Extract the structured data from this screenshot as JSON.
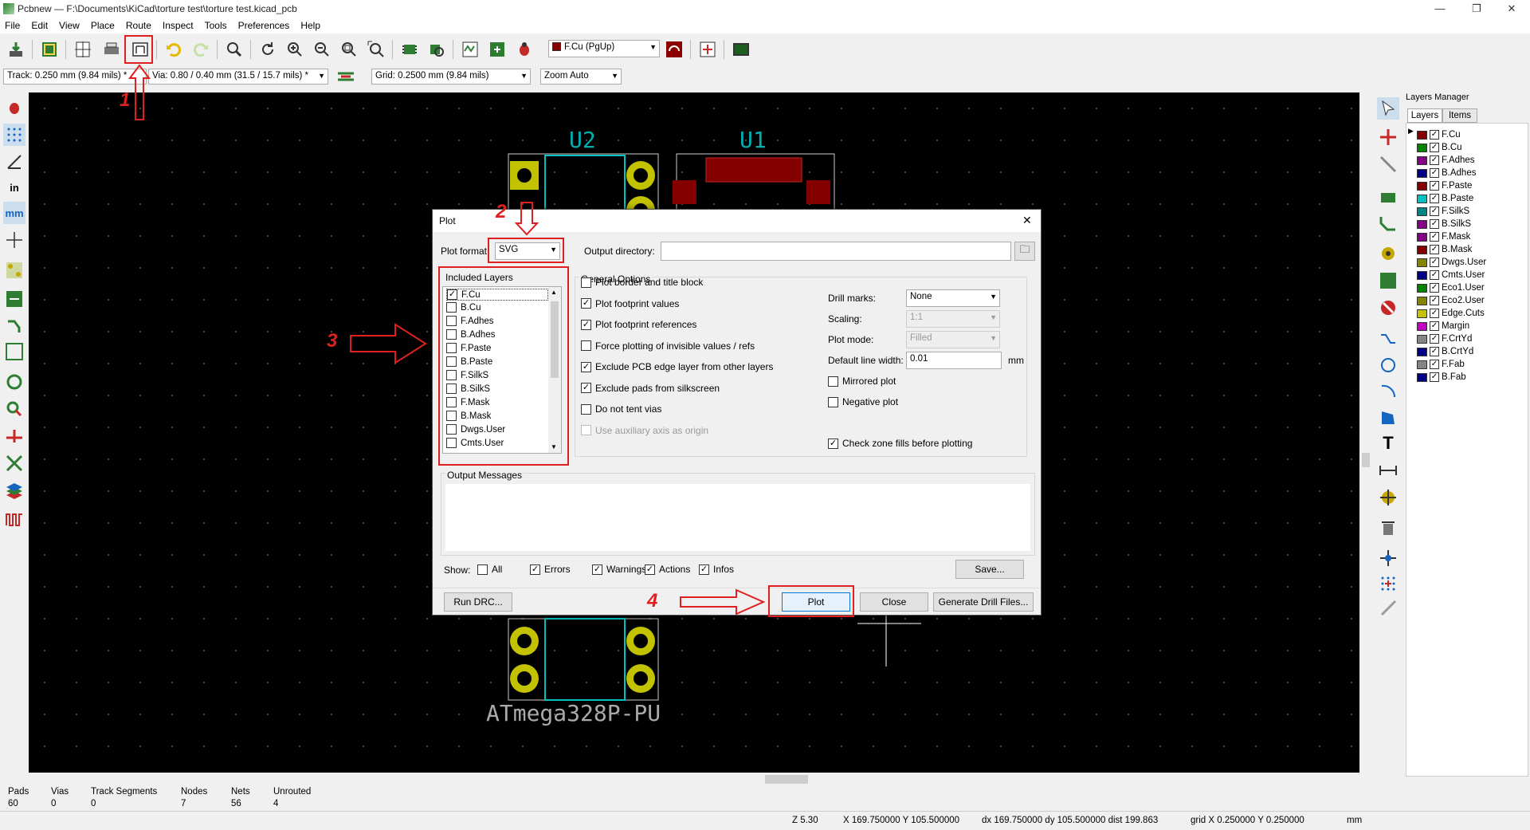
{
  "window": {
    "title": "Pcbnew — F:\\Documents\\KiCad\\torture test\\torture test.kicad_pcb",
    "minimize": "—",
    "maximize": "❐",
    "close": "✕"
  },
  "menu": [
    "File",
    "Edit",
    "View",
    "Place",
    "Route",
    "Inspect",
    "Tools",
    "Preferences",
    "Help"
  ],
  "toolbar": {
    "layer_select": "F.Cu (PgUp)"
  },
  "toolbar2": {
    "track": "Track: 0.250 mm (9.84 mils) *",
    "via": "Via: 0.80 / 0.40 mm (31.5 / 15.7 mils) *",
    "grid": "Grid: 0.2500 mm (9.84 mils)",
    "zoom": "Zoom Auto"
  },
  "pcb": {
    "u2": "U2",
    "u1": "U1",
    "part": "ATmega328P-PU"
  },
  "annotations": [
    "1",
    "2",
    "3",
    "4"
  ],
  "dialog": {
    "title": "Plot",
    "close": "✕",
    "plot_format_label": "Plot format:",
    "plot_format_value": "SVG",
    "output_dir_label": "Output directory:",
    "output_dir_value": "",
    "included_layers_title": "Included Layers",
    "layers": [
      {
        "name": "F.Cu",
        "checked": true
      },
      {
        "name": "B.Cu",
        "checked": false
      },
      {
        "name": "F.Adhes",
        "checked": false
      },
      {
        "name": "B.Adhes",
        "checked": false
      },
      {
        "name": "F.Paste",
        "checked": false
      },
      {
        "name": "B.Paste",
        "checked": false
      },
      {
        "name": "F.SilkS",
        "checked": false
      },
      {
        "name": "B.SilkS",
        "checked": false
      },
      {
        "name": "F.Mask",
        "checked": false
      },
      {
        "name": "B.Mask",
        "checked": false
      },
      {
        "name": "Dwgs.User",
        "checked": false
      },
      {
        "name": "Cmts.User",
        "checked": false
      }
    ],
    "general_title": "General Options",
    "opts_left": [
      {
        "label": "Plot border and title block",
        "checked": false,
        "disabled": false
      },
      {
        "label": "Plot footprint values",
        "checked": true,
        "disabled": false
      },
      {
        "label": "Plot footprint references",
        "checked": true,
        "disabled": false
      },
      {
        "label": "Force plotting of invisible values / refs",
        "checked": false,
        "disabled": false
      },
      {
        "label": "Exclude PCB edge layer from other layers",
        "checked": true,
        "disabled": false
      },
      {
        "label": "Exclude pads from silkscreen",
        "checked": true,
        "disabled": false
      },
      {
        "label": "Do not tent vias",
        "checked": false,
        "disabled": false
      },
      {
        "label": "Use auxiliary axis as origin",
        "checked": false,
        "disabled": true
      }
    ],
    "drill_marks_label": "Drill marks:",
    "drill_marks_value": "None",
    "scaling_label": "Scaling:",
    "scaling_value": "1:1",
    "plot_mode_label": "Plot mode:",
    "plot_mode_value": "Filled",
    "line_width_label": "Default line width:",
    "line_width_value": "0.01",
    "line_width_unit": "mm",
    "mirrored": "Mirrored plot",
    "negative": "Negative plot",
    "check_zone": "Check zone fills before plotting",
    "output_messages": "Output Messages",
    "show_label": "Show:",
    "show_opts": [
      {
        "label": "All",
        "checked": false
      },
      {
        "label": "Errors",
        "checked": true
      },
      {
        "label": "Warnings",
        "checked": true
      },
      {
        "label": "Actions",
        "checked": true
      },
      {
        "label": "Infos",
        "checked": true
      }
    ],
    "save_btn": "Save...",
    "run_drc": "Run DRC...",
    "plot_btn": "Plot",
    "close_btn": "Close",
    "drill_btn": "Generate Drill Files..."
  },
  "layers_manager": {
    "title": "Layers Manager",
    "tab_layers": "Layers",
    "tab_items": "Items",
    "layers": [
      {
        "name": "F.Cu",
        "color": "#840000"
      },
      {
        "name": "B.Cu",
        "color": "#008400"
      },
      {
        "name": "F.Adhes",
        "color": "#840084"
      },
      {
        "name": "B.Adhes",
        "color": "#000084"
      },
      {
        "name": "F.Paste",
        "color": "#840000"
      },
      {
        "name": "B.Paste",
        "color": "#00c2c2"
      },
      {
        "name": "F.SilkS",
        "color": "#008484"
      },
      {
        "name": "B.SilkS",
        "color": "#840084"
      },
      {
        "name": "F.Mask",
        "color": "#840084"
      },
      {
        "name": "B.Mask",
        "color": "#840000"
      },
      {
        "name": "Dwgs.User",
        "color": "#848400"
      },
      {
        "name": "Cmts.User",
        "color": "#000084"
      },
      {
        "name": "Eco1.User",
        "color": "#008400"
      },
      {
        "name": "Eco2.User",
        "color": "#848400"
      },
      {
        "name": "Edge.Cuts",
        "color": "#c2c200"
      },
      {
        "name": "Margin",
        "color": "#c200c2"
      },
      {
        "name": "F.CrtYd",
        "color": "#848484"
      },
      {
        "name": "B.CrtYd",
        "color": "#000084"
      },
      {
        "name": "F.Fab",
        "color": "#848484"
      },
      {
        "name": "B.Fab",
        "color": "#000084"
      }
    ]
  },
  "status": {
    "pads_l": "Pads",
    "pads_v": "60",
    "vias_l": "Vias",
    "vias_v": "0",
    "tracks_l": "Track Segments",
    "tracks_v": "0",
    "nodes_l": "Nodes",
    "nodes_v": "7",
    "nets_l": "Nets",
    "nets_v": "56",
    "unrouted_l": "Unrouted",
    "unrouted_v": "4",
    "zoom": "Z 5.30",
    "xy": "X 169.750000  Y 105.500000",
    "dxy": "dx 169.750000  dy 105.500000  dist 199.863",
    "grid": "grid X 0.250000  Y 0.250000",
    "unit": "mm"
  }
}
